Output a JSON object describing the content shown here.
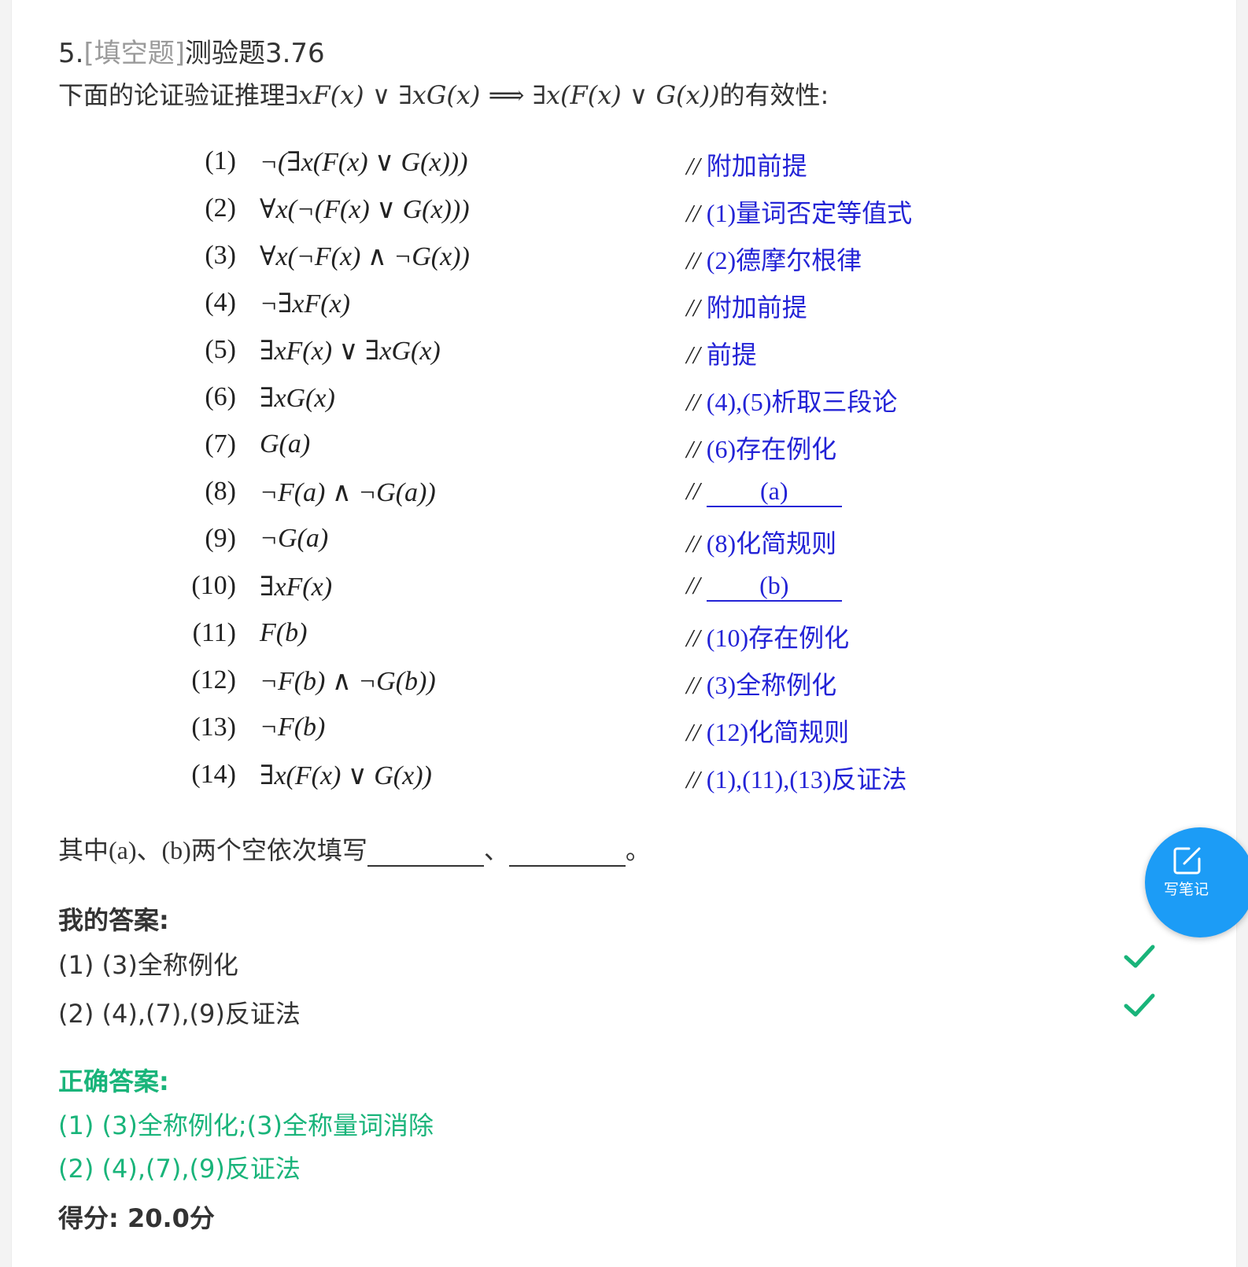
{
  "question": {
    "number": "5.",
    "type": "[填空题]",
    "title": "测验题3.76",
    "stem_prefix": "下面的论证验证推理",
    "stem_formula": "∃xF(x) ∨ ∃xG(x)  ⟹  ∃x(F(x) ∨ G(x))",
    "stem_suffix": "的有效性:"
  },
  "proof": [
    {
      "n": "(1)",
      "formula": "¬(∃x(F(x) ∨ G(x)))",
      "comment": "附加前提"
    },
    {
      "n": "(2)",
      "formula": "∀x(¬(F(x) ∨ G(x)))",
      "comment": "(1)量词否定等值式"
    },
    {
      "n": "(3)",
      "formula": "∀x(¬F(x) ∧ ¬G(x))",
      "comment": "(2)德摩尔根律"
    },
    {
      "n": "(4)",
      "formula": "¬∃xF(x)",
      "comment": "附加前提"
    },
    {
      "n": "(5)",
      "formula": "∃xF(x) ∨ ∃xG(x)",
      "comment": "前提"
    },
    {
      "n": "(6)",
      "formula": "∃xG(x)",
      "comment": "(4),(5)析取三段论"
    },
    {
      "n": "(7)",
      "formula": "G(a)",
      "comment": "(6)存在例化"
    },
    {
      "n": "(8)",
      "formula": "¬F(a) ∧ ¬G(a))",
      "blank": "(a)"
    },
    {
      "n": "(9)",
      "formula": "¬G(a)",
      "comment": "(8)化简规则"
    },
    {
      "n": "(10)",
      "formula": "∃xF(x)",
      "blank": "(b)"
    },
    {
      "n": "(11)",
      "formula": "F(b)",
      "comment": "(10)存在例化"
    },
    {
      "n": "(12)",
      "formula": "¬F(b) ∧ ¬G(b))",
      "comment": "(3)全称例化"
    },
    {
      "n": "(13)",
      "formula": "¬F(b)",
      "comment": "(12)化简规则"
    },
    {
      "n": "(14)",
      "formula": "∃x(F(x) ∨ G(x))",
      "comment": "(1),(11),(13)反证法"
    }
  ],
  "comment_prefix": "//",
  "fill_prompt": {
    "before": "其中(a)、(b)两个空依次填写",
    "sep": "、",
    "end": "。"
  },
  "my_answer": {
    "label": "我的答案:",
    "items": [
      "(1) (3)全称例化",
      "(2) (4),(7),(9)反证法"
    ]
  },
  "correct_answer": {
    "label": "正确答案:",
    "items": [
      "(1) (3)全称例化;(3)全称量词消除",
      "(2) (4),(7),(9)反证法"
    ]
  },
  "score": "得分: 20.0分",
  "note_button": "写笔记",
  "colors": {
    "correct": "#19b47a",
    "comment": "#2323d6",
    "fab": "#1c9cf6",
    "check": "#19b47a"
  }
}
